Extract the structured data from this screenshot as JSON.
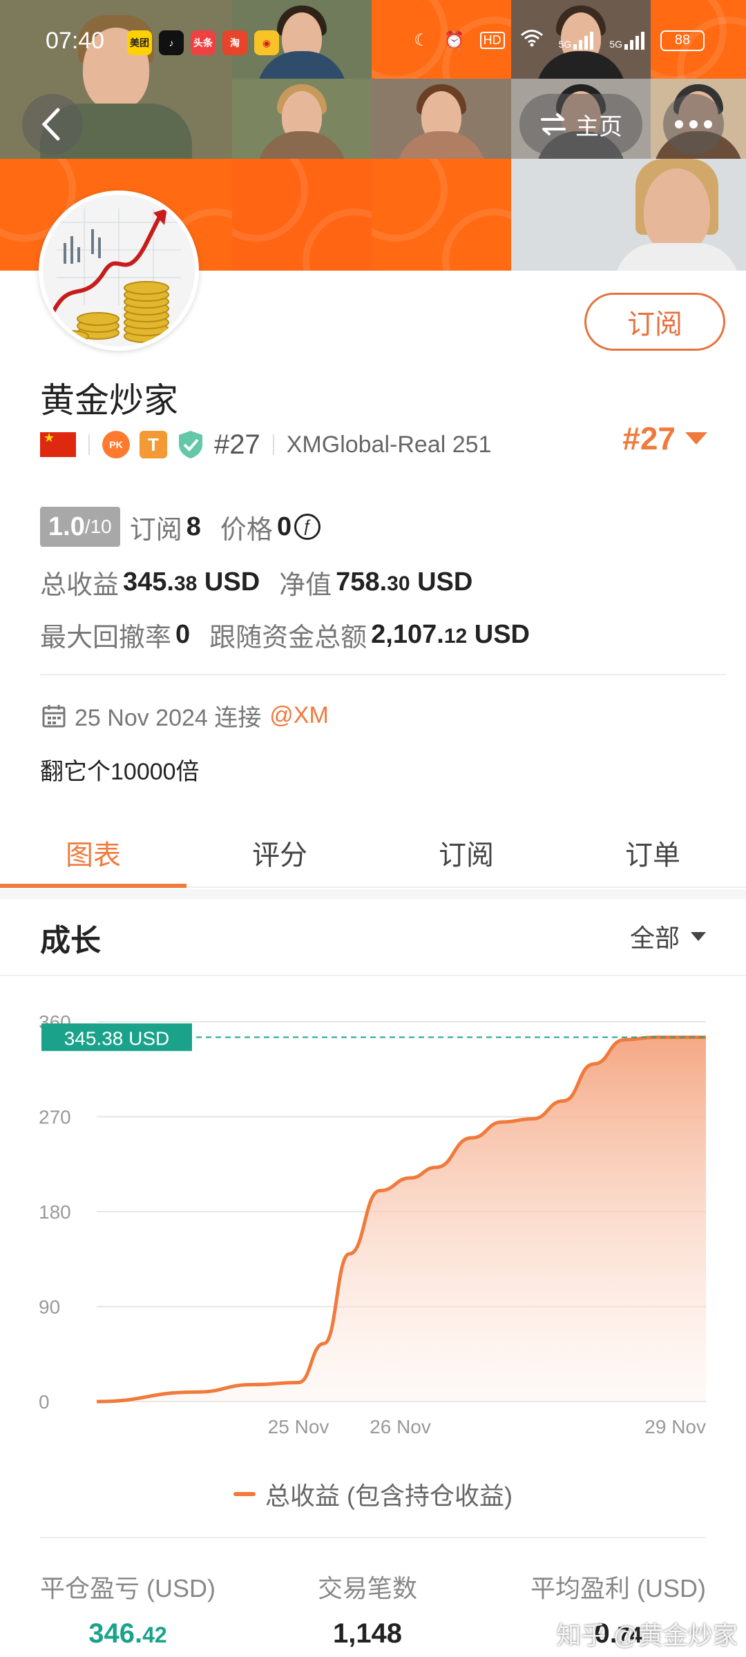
{
  "status_bar": {
    "time": "07:40",
    "apps": [
      {
        "label": "美团",
        "icon": "meituan-icon",
        "bg": "#ffd100",
        "fg": "#222"
      },
      {
        "label": "♪",
        "icon": "tiktok-icon",
        "bg": "#111111",
        "fg": "#fff"
      },
      {
        "label": "头条",
        "icon": "toutiao-icon",
        "bg": "#f04142",
        "fg": "#fff"
      },
      {
        "label": "淘",
        "icon": "taobao-icon",
        "bg": "#e8442a",
        "fg": "#fff"
      },
      {
        "label": "◉",
        "icon": "weibo-icon",
        "bg": "#f7c327",
        "fg": "#d61c1c"
      }
    ],
    "network": [
      "5G",
      "5G"
    ],
    "hd_label": "HD",
    "battery": "88"
  },
  "nav": {
    "home_label": "主页"
  },
  "profile": {
    "name": "黄金炒家",
    "rank_label": "#27",
    "broker": "XMGlobal-Real 251",
    "rank_big": "#27",
    "subscribe_label": "订阅",
    "score": "1.0",
    "score_total": "/10",
    "subscribers_label": "订阅",
    "subscribers": "8",
    "price_label": "价格",
    "price": "0",
    "total_profit_label": "总收益",
    "total_profit_int": "345.",
    "total_profit_dec": "38",
    "total_profit_unit": " USD",
    "equity_label": "净值",
    "equity_int": "758.",
    "equity_dec": "30",
    "equity_unit": " USD",
    "max_drawdown_label": "最大回撤率",
    "max_drawdown": "0",
    "follow_funds_label": "跟随资金总额",
    "follow_funds_int": "2,107.",
    "follow_funds_dec": "12",
    "follow_funds_unit": " USD",
    "joined_text": "25 Nov 2024 连接",
    "joined_at": "@XM",
    "bio": "翻它个10000倍"
  },
  "tabs": [
    {
      "label": "图表",
      "active": true
    },
    {
      "label": "评分",
      "active": false
    },
    {
      "label": "订阅",
      "active": false
    },
    {
      "label": "订单",
      "active": false
    }
  ],
  "section": {
    "title": "成长",
    "filter": "全部"
  },
  "chart_data": {
    "type": "area",
    "y_ticks": [
      "0",
      "90",
      "180",
      "270",
      "360"
    ],
    "ylim": [
      0,
      360
    ],
    "x_tick_labels": [
      {
        "label": "25 Nov",
        "x": 1
      },
      {
        "label": "26 Nov",
        "x": 2
      },
      {
        "label": "29 Nov",
        "x": 5
      }
    ],
    "xlim": [
      -0.98,
      5
    ],
    "series": [
      {
        "name": "总收益 (包含持仓收益)",
        "color": "#f07a3c",
        "points": [
          [
            -0.98,
            0
          ],
          [
            0.0,
            9
          ],
          [
            0.55,
            16
          ],
          [
            1.0,
            18
          ],
          [
            1.25,
            55
          ],
          [
            1.5,
            140
          ],
          [
            1.8,
            200
          ],
          [
            2.1,
            212
          ],
          [
            2.35,
            222
          ],
          [
            2.7,
            250
          ],
          [
            3.0,
            265
          ],
          [
            3.3,
            268
          ],
          [
            3.6,
            285
          ],
          [
            3.9,
            320
          ],
          [
            4.2,
            343
          ],
          [
            4.5,
            345.38
          ],
          [
            5.0,
            345.38
          ]
        ]
      }
    ],
    "current_label": "345.38 USD",
    "current_value": 345.38,
    "legend": "总收益 (包含持仓收益)",
    "grid": true
  },
  "metrics": [
    {
      "label": "平仓盈亏 (USD)",
      "int": "346.",
      "dec": "42",
      "color": "green"
    },
    {
      "label": "交易笔数",
      "int": "1,148",
      "dec": "",
      "color": "dark"
    },
    {
      "label": "平均盈利 (USD)",
      "int": "0.",
      "dec": "74",
      "color": "dark"
    }
  ],
  "watermark": "知乎 @黄金炒家"
}
